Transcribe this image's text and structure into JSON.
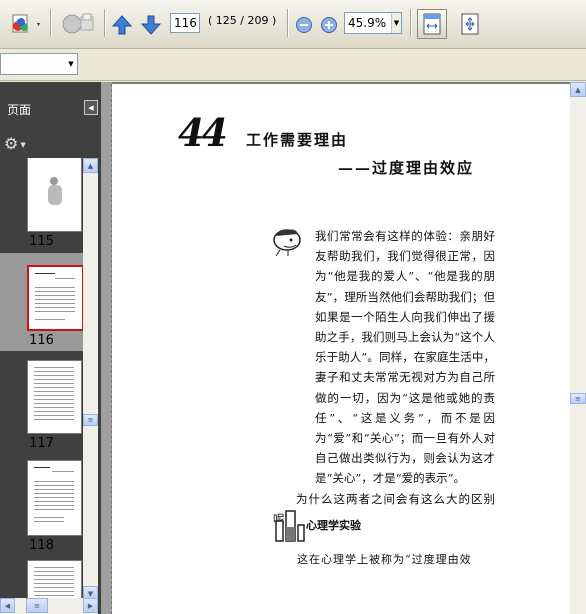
{
  "toolbar": {
    "page_number": "116",
    "page_count": "( 125 / 209 )",
    "zoom": "45.9%"
  },
  "panel": {
    "title": "页面"
  },
  "thumbnails": [
    {
      "label": "115",
      "selected": false
    },
    {
      "label": "116",
      "selected": true
    },
    {
      "label": "117",
      "selected": false
    },
    {
      "label": "118",
      "selected": false
    }
  ],
  "document": {
    "chapter_number": "44",
    "chapter_title": "工作需要理由",
    "chapter_subtitle": "——过度理由效应",
    "paragraphs": [
      "我们常常会有这样的体验：亲朋好友帮助我们，我们觉得很正常，因为“他是我的爱人”、“他是我的朋友”，理所当然他们会帮助我们；但如果是一个陌生人向我们伸出了援助之手，我们则马上会认为“这个人乐于助人”。同样，在家庭生活中，妻子和丈夫常常无视对方为自己所做的一切，因为“这是他或她的责任”、“这是义务”，而不是因为“爱”和“关心”；而一旦有外人对自己做出类似行为，则会认为这才是“关心”，才是“爱的表示”。",
      "为什么这两者之间会有这么大的区别呢？"
    ],
    "section_label": "心理学实验",
    "last_line": "这在心理学上被称为“过度理由效"
  }
}
